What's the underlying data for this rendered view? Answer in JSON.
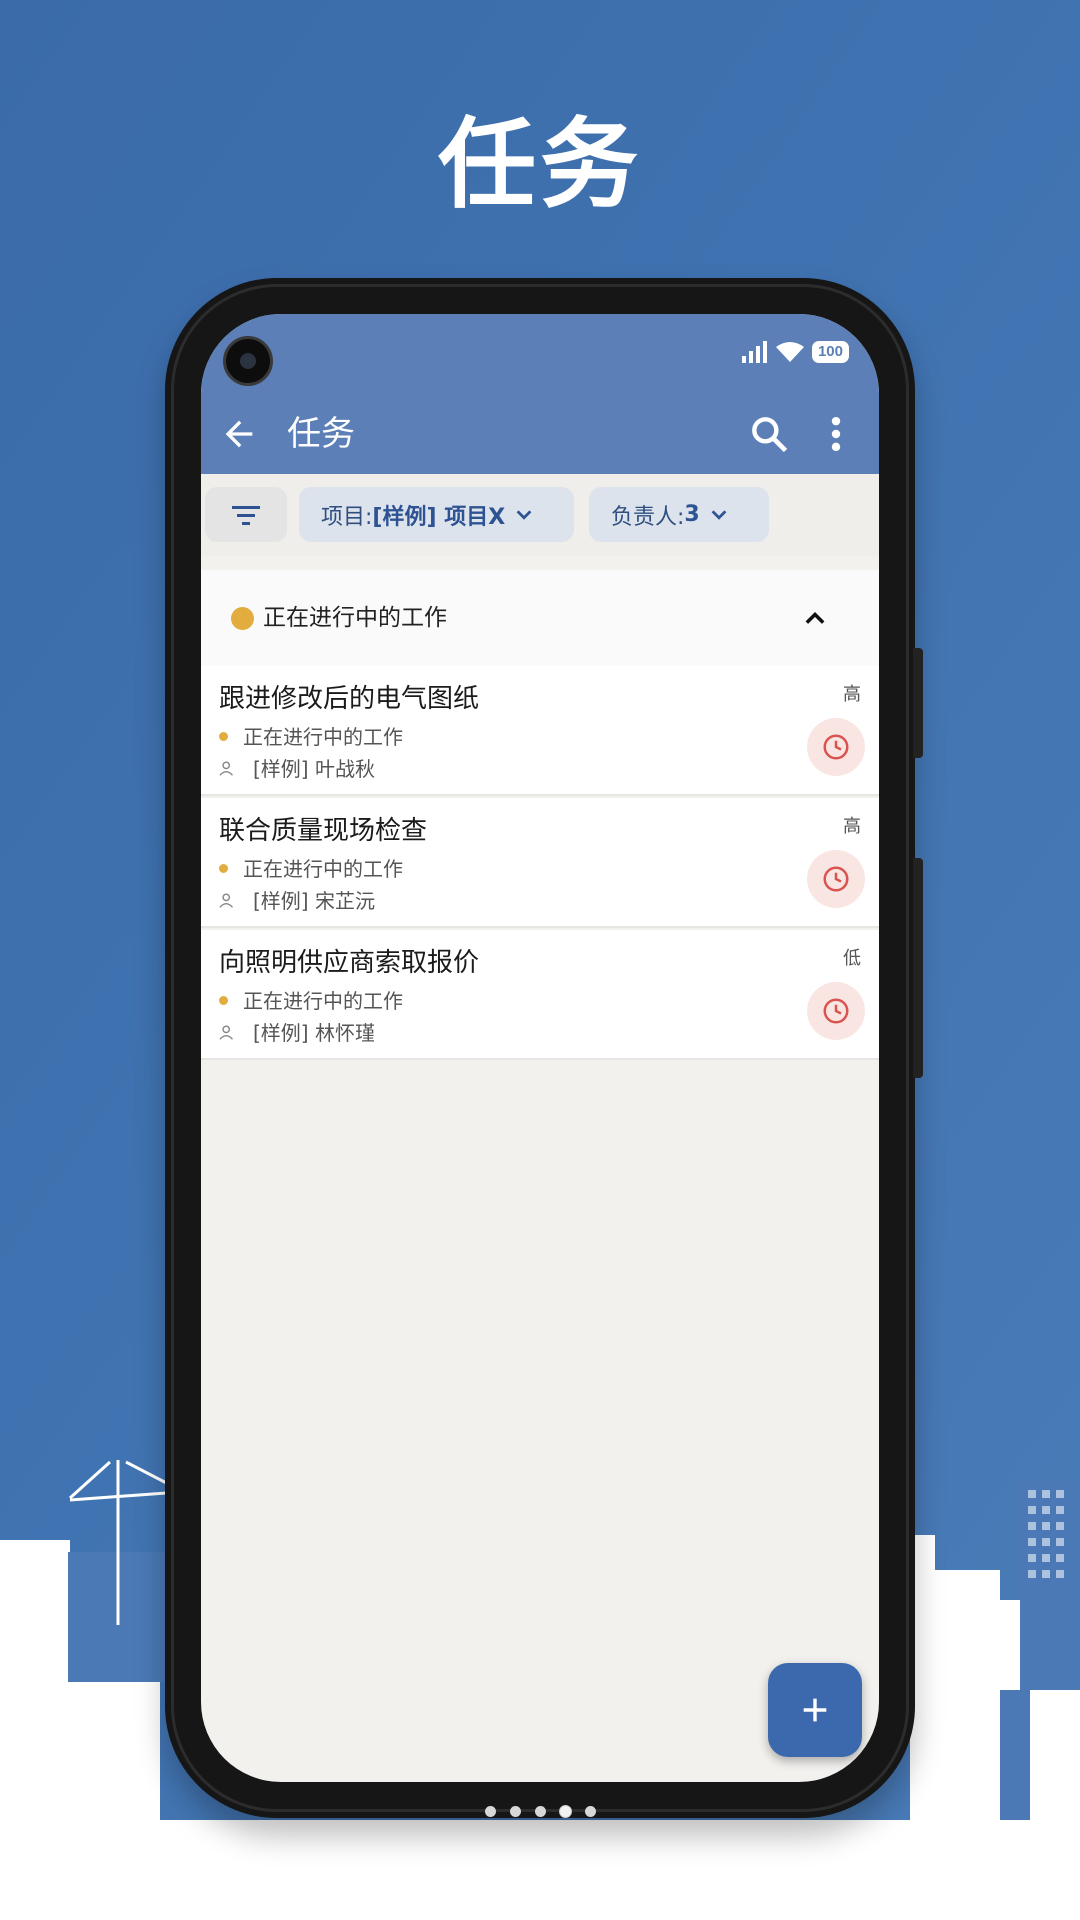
{
  "hero": {
    "title": "任务"
  },
  "status_bar": {
    "battery": "100"
  },
  "toolbar": {
    "title": "任务"
  },
  "filters": {
    "project_label": "项目: ",
    "project_value": "[样例] 项目X",
    "assignee_label": "负责人: ",
    "assignee_value": "3"
  },
  "group": {
    "label": "正在进行中的工作",
    "color": "#e2ac3e"
  },
  "tasks": [
    {
      "title": "跟进修改后的电气图纸",
      "status": "正在进行中的工作",
      "assignee": "[样例] 叶战秋",
      "priority": "高"
    },
    {
      "title": "联合质量现场检查",
      "status": "正在进行中的工作",
      "assignee": "[样例] 宋芷沅",
      "priority": "高"
    },
    {
      "title": "向照明供应商索取报价",
      "status": "正在进行中的工作",
      "assignee": "[样例] 林怀瑾",
      "priority": "低"
    }
  ],
  "pager": {
    "count": 5,
    "active": 4
  },
  "colors": {
    "background": "#3f72b0",
    "appbar": "#5b7fb6",
    "fab": "#3c68ad",
    "accent_dot": "#e2ac3e"
  }
}
